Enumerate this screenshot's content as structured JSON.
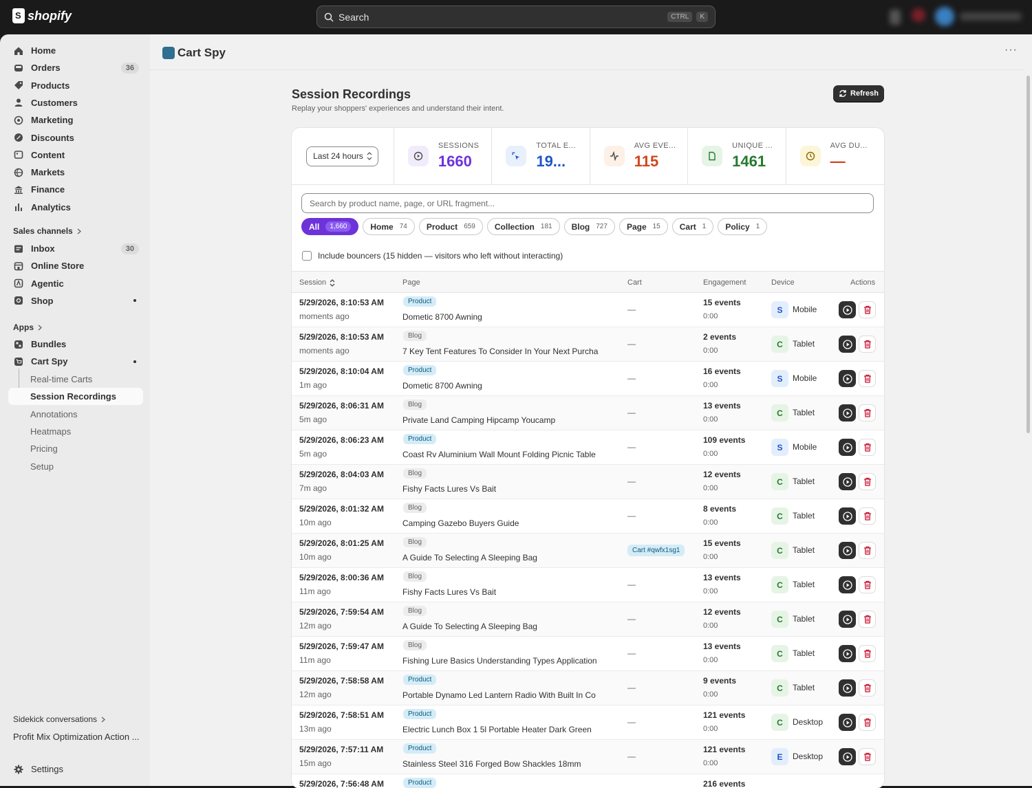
{
  "topbar": {
    "brand": "shopify",
    "search_label": "Search",
    "kbd_ctrl": "CTRL",
    "kbd_k": "K"
  },
  "sidebar": {
    "items": [
      {
        "label": "Home",
        "icon": "home-icon"
      },
      {
        "label": "Orders",
        "icon": "inbox-icon",
        "badge": "36"
      },
      {
        "label": "Products",
        "icon": "tag-icon"
      },
      {
        "label": "Customers",
        "icon": "person-icon"
      },
      {
        "label": "Marketing",
        "icon": "target-icon"
      },
      {
        "label": "Discounts",
        "icon": "discount-icon"
      },
      {
        "label": "Content",
        "icon": "content-icon"
      },
      {
        "label": "Markets",
        "icon": "globe-icon"
      },
      {
        "label": "Finance",
        "icon": "bank-icon"
      },
      {
        "label": "Analytics",
        "icon": "bar-chart-icon"
      }
    ],
    "sales_channels_label": "Sales channels",
    "sales_channels": [
      {
        "label": "Inbox",
        "icon": "chat-icon",
        "badge": "30"
      },
      {
        "label": "Online Store",
        "icon": "store-icon"
      },
      {
        "label": "Agentic",
        "icon": "agentic-icon"
      },
      {
        "label": "Shop",
        "icon": "shop-icon"
      }
    ],
    "apps_label": "Apps",
    "apps": [
      {
        "label": "Bundles",
        "icon": "bundles-icon"
      },
      {
        "label": "Cart Spy",
        "icon": "cart-spy-icon"
      }
    ],
    "cartspy_sub": [
      "Real-time Carts",
      "Session Recordings",
      "Annotations",
      "Heatmaps",
      "Pricing",
      "Setup"
    ],
    "sidekick_label": "Sidekick conversations",
    "sidekick_item": "Profit Mix Optimization Action ...",
    "settings_label": "Settings"
  },
  "app": {
    "title": "Cart Spy",
    "more": "···"
  },
  "page": {
    "title": "Session Recordings",
    "subtitle": "Replay your shoppers' experiences and understand their intent.",
    "refresh_label": "Refresh"
  },
  "stats": {
    "range": "Last 24 hours",
    "items": [
      {
        "label": "SESSIONS",
        "value": "1660",
        "color": "#6d33d9",
        "bg": "#f1ecfb",
        "icon": "play-circle-icon"
      },
      {
        "label": "TOTAL E...",
        "value": "19...",
        "color": "#1e55c8",
        "bg": "#e8f0fc",
        "icon": "cursor-click-icon"
      },
      {
        "label": "AVG EVE...",
        "value": "115",
        "color": "#d1461c",
        "bg": "#fdf0e6",
        "icon": "activity-icon"
      },
      {
        "label": "UNIQUE ...",
        "value": "1461",
        "color": "#257a2e",
        "bg": "#e6f4e6",
        "icon": "file-icon"
      },
      {
        "label": "AVG DU...",
        "value": "—",
        "color": "#d1461c",
        "bg": "#fdf5d8",
        "icon": "clock-icon"
      }
    ]
  },
  "search": {
    "placeholder": "Search by product name, page, or URL fragment..."
  },
  "filters": [
    {
      "label": "All",
      "count": "1,660",
      "active": true
    },
    {
      "label": "Home",
      "count": "74"
    },
    {
      "label": "Product",
      "count": "659"
    },
    {
      "label": "Collection",
      "count": "181"
    },
    {
      "label": "Blog",
      "count": "727"
    },
    {
      "label": "Page",
      "count": "15"
    },
    {
      "label": "Cart",
      "count": "1"
    },
    {
      "label": "Policy",
      "count": "1"
    }
  ],
  "bouncers": "Include bouncers (15 hidden — visitors who left without interacting)",
  "table": {
    "headers": {
      "session": "Session",
      "page": "Page",
      "cart": "Cart",
      "engagement": "Engagement",
      "device": "Device",
      "actions": "Actions"
    },
    "rows": [
      {
        "date": "5/29/2026, 8:10:53 AM",
        "ago": "moments ago",
        "type": "Product",
        "page": "Dometic 8700 Awning",
        "cart": "—",
        "events": "15 events",
        "dur": "0:00",
        "dev_letter": "S",
        "device": "Mobile"
      },
      {
        "date": "5/29/2026, 8:10:53 AM",
        "ago": "moments ago",
        "type": "Blog",
        "page": "7 Key Tent Features To Consider In Your Next Purcha",
        "cart": "—",
        "events": "2 events",
        "dur": "0:00",
        "dev_letter": "C",
        "device": "Tablet"
      },
      {
        "date": "5/29/2026, 8:10:04 AM",
        "ago": "1m ago",
        "type": "Product",
        "page": "Dometic 8700 Awning",
        "cart": "—",
        "events": "16 events",
        "dur": "0:00",
        "dev_letter": "S",
        "device": "Mobile"
      },
      {
        "date": "5/29/2026, 8:06:31 AM",
        "ago": "5m ago",
        "type": "Blog",
        "page": "Private Land Camping Hipcamp Youcamp",
        "cart": "—",
        "events": "13 events",
        "dur": "0:00",
        "dev_letter": "C",
        "device": "Tablet"
      },
      {
        "date": "5/29/2026, 8:06:23 AM",
        "ago": "5m ago",
        "type": "Product",
        "page": "Coast Rv Aluminium Wall Mount Folding Picnic Table",
        "cart": "—",
        "events": "109 events",
        "dur": "0:00",
        "dev_letter": "S",
        "device": "Mobile"
      },
      {
        "date": "5/29/2026, 8:04:03 AM",
        "ago": "7m ago",
        "type": "Blog",
        "page": "Fishy Facts Lures Vs Bait",
        "cart": "—",
        "events": "12 events",
        "dur": "0:00",
        "dev_letter": "C",
        "device": "Tablet"
      },
      {
        "date": "5/29/2026, 8:01:32 AM",
        "ago": "10m ago",
        "type": "Blog",
        "page": "Camping Gazebo Buyers Guide",
        "cart": "—",
        "events": "8 events",
        "dur": "0:00",
        "dev_letter": "C",
        "device": "Tablet"
      },
      {
        "date": "5/29/2026, 8:01:25 AM",
        "ago": "10m ago",
        "type": "Blog",
        "page": "A Guide To Selecting A Sleeping Bag",
        "cart": "Cart #qwfx1sg1",
        "events": "15 events",
        "dur": "0:00",
        "dev_letter": "C",
        "device": "Tablet"
      },
      {
        "date": "5/29/2026, 8:00:36 AM",
        "ago": "11m ago",
        "type": "Blog",
        "page": "Fishy Facts Lures Vs Bait",
        "cart": "—",
        "events": "13 events",
        "dur": "0:00",
        "dev_letter": "C",
        "device": "Tablet"
      },
      {
        "date": "5/29/2026, 7:59:54 AM",
        "ago": "12m ago",
        "type": "Blog",
        "page": "A Guide To Selecting A Sleeping Bag",
        "cart": "—",
        "events": "12 events",
        "dur": "0:00",
        "dev_letter": "C",
        "device": "Tablet"
      },
      {
        "date": "5/29/2026, 7:59:47 AM",
        "ago": "11m ago",
        "type": "Blog",
        "page": "Fishing Lure Basics Understanding Types Application",
        "cart": "—",
        "events": "13 events",
        "dur": "0:00",
        "dev_letter": "C",
        "device": "Tablet"
      },
      {
        "date": "5/29/2026, 7:58:58 AM",
        "ago": "12m ago",
        "type": "Product",
        "page": "Portable Dynamo Led Lantern Radio With Built In Co",
        "cart": "—",
        "events": "9 events",
        "dur": "0:00",
        "dev_letter": "C",
        "device": "Tablet"
      },
      {
        "date": "5/29/2026, 7:58:51 AM",
        "ago": "13m ago",
        "type": "Product",
        "page": "Electric Lunch Box 1 5l Portable Heater Dark Green",
        "cart": "—",
        "events": "121 events",
        "dur": "0:00",
        "dev_letter": "C",
        "device": "Desktop"
      },
      {
        "date": "5/29/2026, 7:57:11 AM",
        "ago": "15m ago",
        "type": "Product",
        "page": "Stainless Steel 316 Forged Bow Shackles 18mm",
        "cart": "—",
        "events": "121 events",
        "dur": "0:00",
        "dev_letter": "E",
        "device": "Desktop"
      },
      {
        "date": "5/29/2026, 7:56:48 AM",
        "ago": "",
        "type": "Product",
        "page": "",
        "cart": "",
        "events": "216 events",
        "dur": "",
        "dev_letter": "",
        "device": ""
      }
    ]
  }
}
